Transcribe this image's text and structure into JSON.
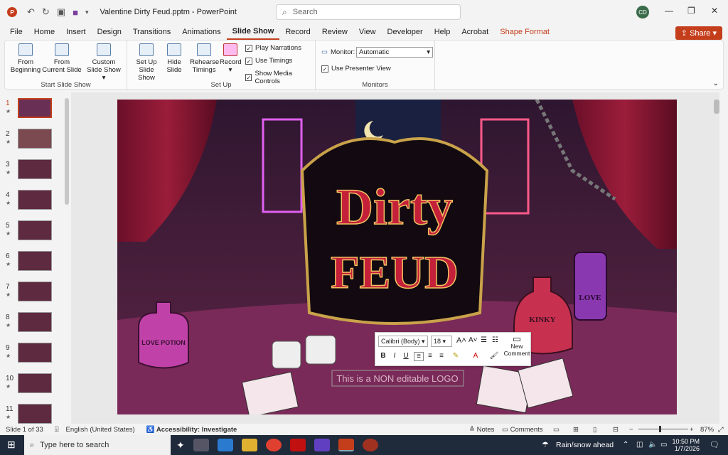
{
  "titlebar": {
    "doc_title": "Valentine Dirty Feud.pptm",
    "app_name": "PowerPoint",
    "search_placeholder": "Search",
    "avatar": "CD"
  },
  "menu": [
    "File",
    "Home",
    "Insert",
    "Design",
    "Transitions",
    "Animations",
    "Slide Show",
    "Record",
    "Review",
    "View",
    "Developer",
    "Help",
    "Acrobat",
    "Shape Format"
  ],
  "share_label": "Share",
  "ribbon": {
    "start": {
      "from_beginning": "From Beginning",
      "from_current": "From Current Slide",
      "custom": "Custom Slide Show",
      "group_label": "Start Slide Show"
    },
    "setup": {
      "set_up": "Set Up Slide Show",
      "hide": "Hide Slide",
      "rehearse": "Rehearse Timings",
      "record": "Record",
      "play_narrations": "Play Narrations",
      "use_timings": "Use Timings",
      "show_media": "Show Media Controls",
      "group_label": "Set Up"
    },
    "monitors": {
      "monitor_label": "Monitor:",
      "monitor_value": "Automatic",
      "presenter_view": "Use Presenter View",
      "group_label": "Monitors"
    }
  },
  "slides": [
    {
      "num": "1",
      "star": "★"
    },
    {
      "num": "2",
      "star": "★"
    },
    {
      "num": "3",
      "star": "★"
    },
    {
      "num": "4",
      "star": "★"
    },
    {
      "num": "5",
      "star": "★"
    },
    {
      "num": "6",
      "star": "★"
    },
    {
      "num": "7",
      "star": "★"
    },
    {
      "num": "8",
      "star": "★"
    },
    {
      "num": "9",
      "star": "★"
    },
    {
      "num": "10",
      "star": "★"
    },
    {
      "num": "11",
      "star": "★"
    }
  ],
  "slide_content": {
    "logo_line1": "Dirty",
    "logo_line2": "FEUD",
    "kinky": "KINKY",
    "love": "LOVE",
    "love_potion": "LOVE POTION",
    "textbox": "This is a NON editable LOGO"
  },
  "mini_toolbar": {
    "font": "Calibri (Body)",
    "size": "18",
    "new_comment": "New Comment"
  },
  "status": {
    "slide_of": "Slide 1 of 33",
    "language": "English (United States)",
    "accessibility": "Accessibility: Investigate",
    "notes": "Notes",
    "comments": "Comments",
    "zoom": "87%"
  },
  "taskbar": {
    "search": "Type here to search",
    "weather": "Rain/snow ahead",
    "time": "10:50 PM",
    "date": "1/7/2026"
  }
}
